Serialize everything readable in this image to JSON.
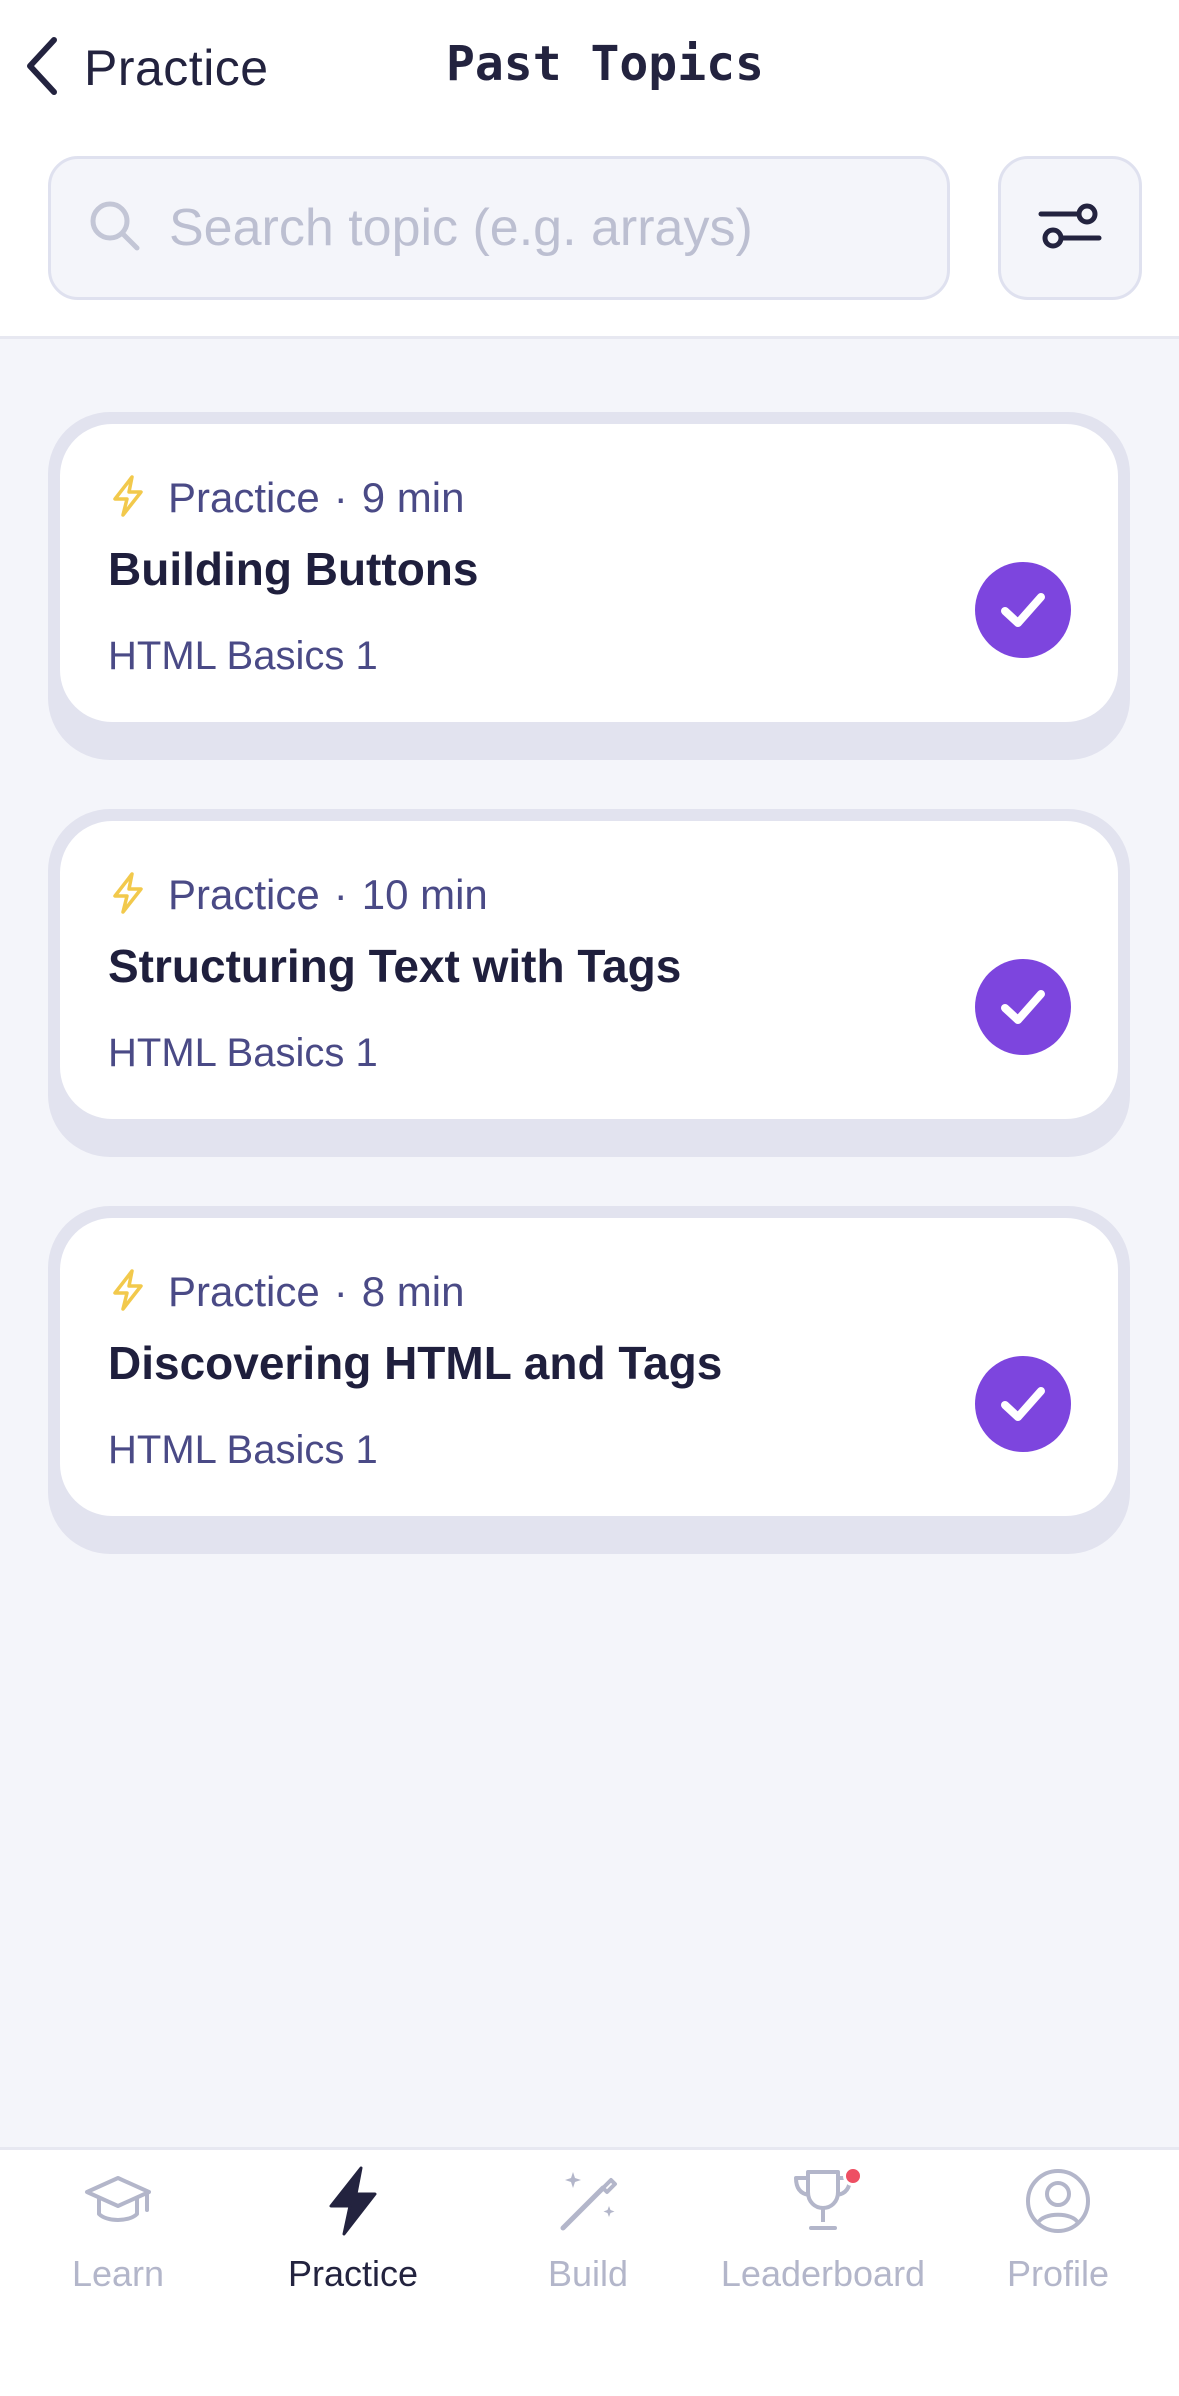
{
  "header": {
    "back_label": "Practice",
    "title": "Past Topics"
  },
  "search": {
    "placeholder": "Search topic (e.g. arrays)",
    "value": ""
  },
  "topics": [
    {
      "type": "Practice",
      "separator": "·",
      "duration": "9 min",
      "title": "Building Buttons",
      "course": "HTML Basics 1",
      "completed": true
    },
    {
      "type": "Practice",
      "separator": "·",
      "duration": "10 min",
      "title": "Structuring Text with Tags",
      "course": "HTML Basics 1",
      "completed": true
    },
    {
      "type": "Practice",
      "separator": "·",
      "duration": "8 min",
      "title": "Discovering HTML and Tags",
      "course": "HTML Basics 1",
      "completed": true
    }
  ],
  "tabbar": {
    "items": [
      {
        "label": "Learn",
        "icon": "graduation-cap-icon",
        "active": false
      },
      {
        "label": "Practice",
        "icon": "lightning-icon",
        "active": true
      },
      {
        "label": "Build",
        "icon": "magic-wand-icon",
        "active": false
      },
      {
        "label": "Leaderboard",
        "icon": "trophy-icon",
        "active": false,
        "notification": true
      },
      {
        "label": "Profile",
        "icon": "user-circle-icon",
        "active": false
      }
    ]
  },
  "colors": {
    "accent": "#7d45de",
    "text_primary": "#23233f",
    "text_secondary": "#4a4a86",
    "lightning": "#f2c94c",
    "tab_inactive": "#b3b6ca",
    "background": "#f4f5fa",
    "notification": "#ee4f63"
  }
}
